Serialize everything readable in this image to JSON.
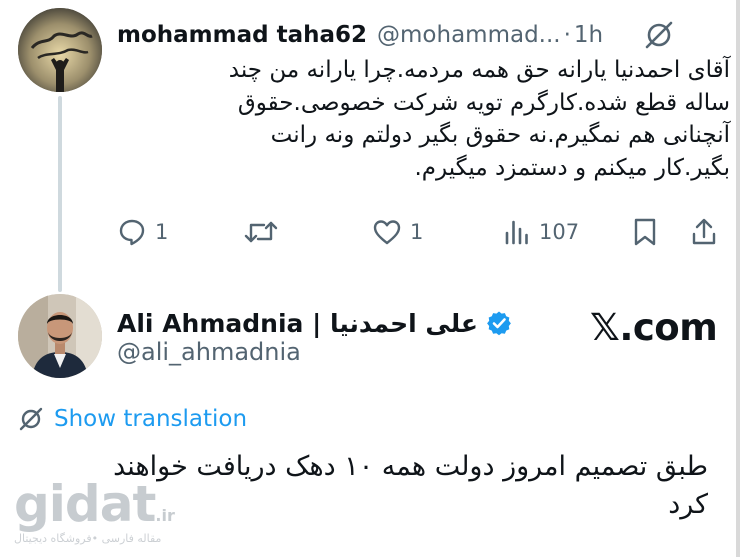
{
  "reply": {
    "avatar_caption": "",
    "display_name": "mohammad taha62",
    "handle": "@mohammad...",
    "separator": "·",
    "time": "1h",
    "text_lines": [
      "آقای احمدنیا یارانه حق همه مردمه.چرا یارانه من چند",
      "ساله قطع شده.کارگرم تویه شرکت خصوصی.حقوق",
      "آنچنانی هم نمگیرم.نه حقوق بگیر دولتم ونه رانت",
      "بگیر.کار میکنم و دستمزد میگیرم."
    ],
    "actions": {
      "replies": "1",
      "retweets": "",
      "likes": "1",
      "views": "107"
    }
  },
  "quoted": {
    "display_name": "Ali Ahmadnia | علی احمدنیا",
    "handle": "@ali_ahmadnia",
    "translate_label": "Show translation",
    "text_lines": [
      "طبق تصمیم امروز دولت همه ۱۰ دهک دریافت خواهند",
      "کرد"
    ]
  },
  "brand": {
    "x_logo": "𝕏",
    "suffix": ".com"
  },
  "watermark": {
    "main": "gidat",
    "tld": ".ir",
    "subtitle": "مقاله فارسی •فروشگاه دیجیتال"
  },
  "colors": {
    "accent": "#1d9bf0",
    "text": "#0f1419",
    "muted": "#536471"
  }
}
